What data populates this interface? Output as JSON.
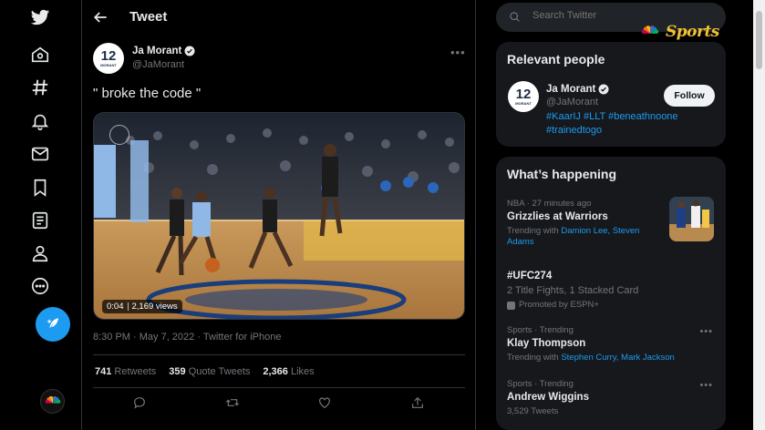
{
  "colors": {
    "accent": "#1d9bf0",
    "background": "#000000",
    "panel": "#16181c",
    "muted": "#71767b",
    "text": "#e7e9ea",
    "nbc_gold": "#f1c232"
  },
  "nav": {
    "items": [
      "twitter-logo-icon",
      "home-icon",
      "explore-icon",
      "notifications-icon",
      "messages-icon",
      "bookmarks-icon",
      "lists-icon",
      "profile-icon",
      "more-icon"
    ],
    "compose_icon": "compose-icon",
    "avatar_label": "NBC"
  },
  "header": {
    "title": "Tweet"
  },
  "tweet": {
    "author_name": "Ja Morant",
    "author_handle": "@JaMorant",
    "avatar_number": "12",
    "avatar_name": "MORANT",
    "text": "\" broke the code \"",
    "video_time": "0:04",
    "video_views": "2,169 views",
    "meta": "8:30 PM · May 7, 2022 · Twitter for iPhone",
    "retweets_count": "741",
    "retweets_label": "Retweets",
    "quotes_count": "359",
    "quotes_label": "Quote Tweets",
    "likes_count": "2,366",
    "likes_label": "Likes"
  },
  "search": {
    "placeholder": "Search Twitter"
  },
  "watermark": {
    "word": "Sports"
  },
  "relevant_people": {
    "title": "Relevant people",
    "name": "Ja Morant",
    "handle": "@JaMorant",
    "bio": "#KaarIJ #LLT #beneathnoone #trainedtogo",
    "follow_label": "Follow"
  },
  "whats_happening": {
    "title": "What’s happening",
    "trends": [
      {
        "context": "NBA · 27 minutes ago",
        "title": "Grizzlies at Warriors",
        "sub_prefix": "Trending with ",
        "sub_links": "Damion Lee, Steven Adams"
      },
      {
        "context": "",
        "title": "#UFC274",
        "sub": "2 Title Fights, 1 Stacked Card",
        "promo": "Promoted by ESPN+"
      },
      {
        "context": "Sports · Trending",
        "title": "Klay Thompson",
        "sub_prefix": "Trending with ",
        "sub_links": "Stephen Curry, Mark Jackson"
      },
      {
        "context": "Sports · Trending",
        "title": "Andrew Wiggins",
        "sub": "3,529 Tweets"
      }
    ]
  }
}
